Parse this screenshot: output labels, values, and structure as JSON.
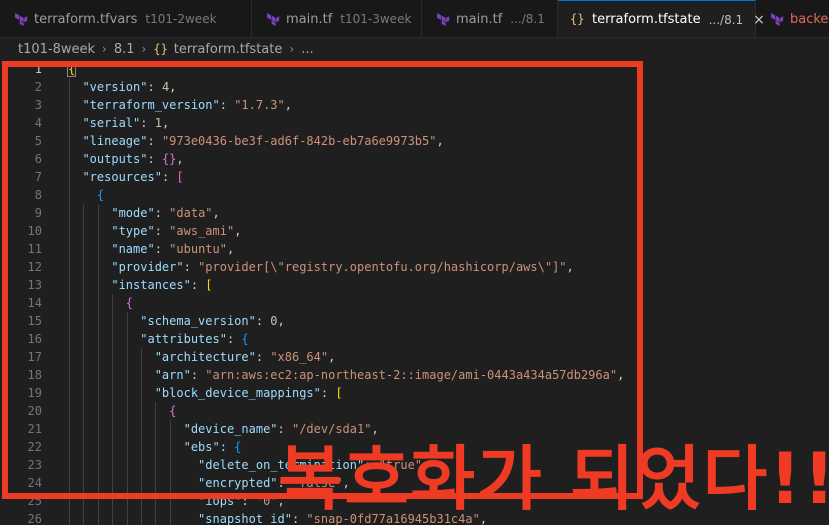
{
  "tabs": [
    {
      "label": "terraform.tfvars",
      "desc": "t101-2week"
    },
    {
      "label": "main.tf",
      "desc": "t101-3week"
    },
    {
      "label": "main.tf",
      "desc": ".../8.1"
    },
    {
      "label": "terraform.tfstate",
      "desc": ".../8.1",
      "close": "×"
    },
    {
      "label": "backer"
    }
  ],
  "breadcrumb": {
    "part1": "t101-8week",
    "part2": "8.1",
    "part3": "terraform.tfstate",
    "part4": "..."
  },
  "lines": [
    {
      "num": "1"
    },
    {
      "num": "2"
    },
    {
      "num": "3"
    },
    {
      "num": "4"
    },
    {
      "num": "5"
    },
    {
      "num": "6"
    },
    {
      "num": "7"
    },
    {
      "num": "8"
    },
    {
      "num": "9"
    },
    {
      "num": "10"
    },
    {
      "num": "11"
    },
    {
      "num": "12"
    },
    {
      "num": "13"
    },
    {
      "num": "14"
    },
    {
      "num": "15"
    },
    {
      "num": "16"
    },
    {
      "num": "17"
    },
    {
      "num": "18"
    },
    {
      "num": "19"
    },
    {
      "num": "20"
    },
    {
      "num": "21"
    },
    {
      "num": "22"
    },
    {
      "num": "23"
    },
    {
      "num": "24"
    },
    {
      "num": "25"
    },
    {
      "num": "26"
    }
  ],
  "code": {
    "version_key": "\"version\"",
    "version_val": "4",
    "tfver_key": "\"terraform_version\"",
    "tfver_val": "\"1.7.3\"",
    "serial_key": "\"serial\"",
    "serial_val": "1",
    "lineage_key": "\"lineage\"",
    "lineage_val": "\"973e0436-be3f-ad6f-842b-eb7a6e9973b5\"",
    "outputs_key": "\"outputs\"",
    "resources_key": "\"resources\"",
    "mode_key": "\"mode\"",
    "mode_val": "\"data\"",
    "type_key": "\"type\"",
    "type_val": "\"aws_ami\"",
    "name_key": "\"name\"",
    "name_val": "\"ubuntu\"",
    "provider_key": "\"provider\"",
    "provider_val": "\"provider[\\\"registry.opentofu.org/hashicorp/aws\\\"]\"",
    "instances_key": "\"instances\"",
    "schema_key": "\"schema_version\"",
    "schema_val": "0",
    "attributes_key": "\"attributes\"",
    "arch_key": "\"architecture\"",
    "arch_val": "\"x86_64\"",
    "arn_key": "\"arn\"",
    "arn_val": "\"arn:aws:ec2:ap-northeast-2::image/ami-0443a434a57db296a\"",
    "bdm_key": "\"block_device_mappings\"",
    "devname_key": "\"device_name\"",
    "devname_val": "\"/dev/sda1\"",
    "ebs_key": "\"ebs\"",
    "dot_key": "\"delete_on_termination\"",
    "dot_val": "\"true\"",
    "enc_key": "\"encrypted\"",
    "enc_val": "\"false\"",
    "iops_key": "\"iops\"",
    "iops_val": "\"0\"",
    "snap_key": "\"snapshot_id\"",
    "snap_val": "\"snap-0fd77a16945b31c4a\""
  },
  "annotation": {
    "text": "복호화가 되었다!!",
    "color": "#ef3b24"
  }
}
